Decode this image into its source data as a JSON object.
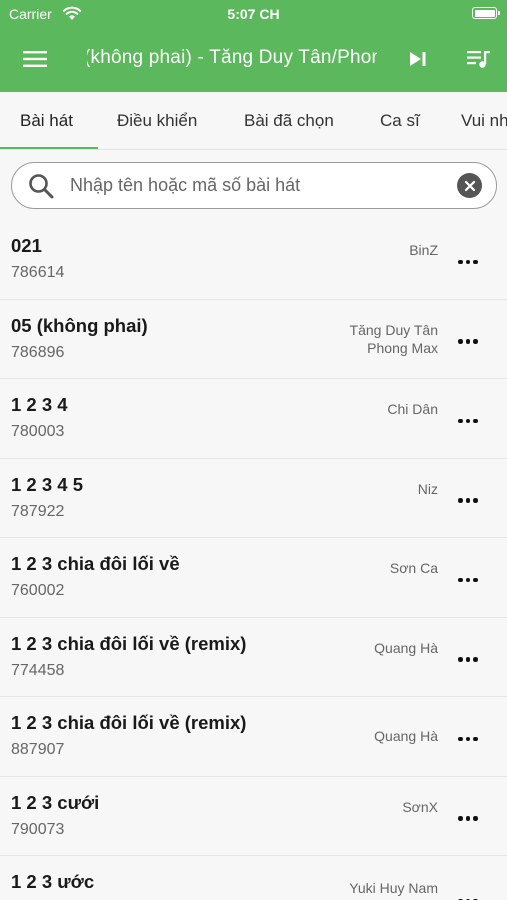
{
  "status_bar": {
    "carrier": "Carrier",
    "time": "5:07 CH"
  },
  "header": {
    "now_playing": "(không phai) - Tăng Duy Tân/Phong Max"
  },
  "tabs": [
    {
      "label": "Bài hát",
      "active": true
    },
    {
      "label": "Điều khiển",
      "active": false
    },
    {
      "label": "Bài đã chọn",
      "active": false
    },
    {
      "label": "Ca sĩ",
      "active": false
    },
    {
      "label": "Vui nhộn",
      "active": false
    }
  ],
  "search": {
    "placeholder": "Nhập tên hoặc mã số bài hát",
    "value": ""
  },
  "songs": [
    {
      "title": "021",
      "code": "786614",
      "artist": "BinZ",
      "artist2": ""
    },
    {
      "title": "05 (không phai)",
      "code": "786896",
      "artist": "Tăng Duy Tân",
      "artist2": "Phong Max"
    },
    {
      "title": "1 2 3 4",
      "code": "780003",
      "artist": "Chi Dân",
      "artist2": ""
    },
    {
      "title": "1 2 3 4 5",
      "code": "787922",
      "artist": "Niz",
      "artist2": ""
    },
    {
      "title": "1 2 3 chia đôi lối về",
      "code": "760002",
      "artist": "Sơn Ca",
      "artist2": ""
    },
    {
      "title": "1 2 3 chia đôi lối về (remix)",
      "code": "774458",
      "artist": "Quang Hà",
      "artist2": ""
    },
    {
      "title": "1 2 3 chia đôi lối về (remix)",
      "code": "887907",
      "artist": "Quang Hà",
      "artist2": ""
    },
    {
      "title": "1 2 3 cưới",
      "code": "790073",
      "artist": "SơnX",
      "artist2": ""
    },
    {
      "title": "1 2 3 ước",
      "code": "",
      "artist": "Yuki Huy Nam",
      "artist2": ""
    }
  ],
  "colors": {
    "accent": "#5cb85c",
    "background": "#f7f7f7"
  }
}
